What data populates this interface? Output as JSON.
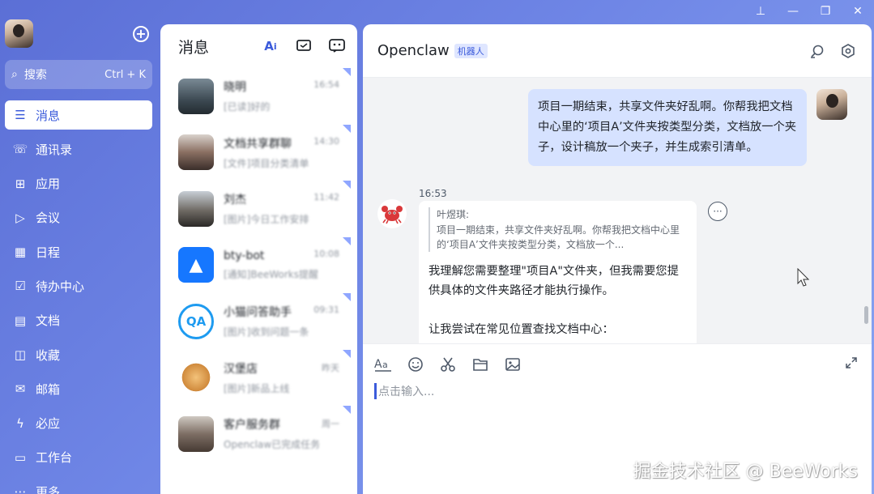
{
  "window": {
    "controls": [
      "⊥",
      "—",
      "❐",
      "✕"
    ]
  },
  "nav": {
    "search_label": "搜索",
    "search_shortcut": "Ctrl + K",
    "items": [
      {
        "label": "消息",
        "icon": "message-icon",
        "glyph": "☰",
        "active": true
      },
      {
        "label": "通讯录",
        "icon": "contacts-icon",
        "glyph": "☏",
        "active": false
      },
      {
        "label": "应用",
        "icon": "apps-icon",
        "glyph": "⊞",
        "active": false
      },
      {
        "label": "会议",
        "icon": "meeting-icon",
        "glyph": "▷",
        "active": false
      },
      {
        "label": "日程",
        "icon": "calendar-icon",
        "glyph": "▦",
        "active": false
      },
      {
        "label": "待办中心",
        "icon": "todo-icon",
        "glyph": "☑",
        "active": false
      },
      {
        "label": "文档",
        "icon": "document-icon",
        "glyph": "▤",
        "active": false
      },
      {
        "label": "收藏",
        "icon": "favorites-icon",
        "glyph": "◫",
        "active": false
      },
      {
        "label": "邮箱",
        "icon": "mail-icon",
        "glyph": "✉",
        "active": false
      },
      {
        "label": "必应",
        "icon": "lightning-icon",
        "glyph": "ϟ",
        "active": false
      },
      {
        "label": "工作台",
        "icon": "workbench-icon",
        "glyph": "▭",
        "active": false
      },
      {
        "label": "更多",
        "icon": "more-icon",
        "glyph": "⋯",
        "active": false
      }
    ]
  },
  "conversations": {
    "title": "消息",
    "header_icons": [
      "ai-icon",
      "chat-box-icon",
      "bot-chat-icon"
    ],
    "items": [
      {
        "name": "晓明",
        "preview": "[已读]好的",
        "time": "16:54",
        "avatar": "av-photo1",
        "avatar_text": ""
      },
      {
        "name": "文档共享群聊",
        "preview": "[文件]项目分类清单",
        "time": "14:30",
        "avatar": "av-photo2",
        "avatar_text": ""
      },
      {
        "name": "刘杰",
        "preview": "[图片]今日工作安排",
        "time": "11:42",
        "avatar": "av-photo3",
        "avatar_text": ""
      },
      {
        "name": "bty-bot",
        "preview": "[通知]BeeWorks提醒",
        "time": "10:08",
        "avatar": "av-blue",
        "avatar_text": "▲"
      },
      {
        "name": "小猫问答助手",
        "preview": "[图片]收到问题一条",
        "time": "09:31",
        "avatar": "av-qa",
        "avatar_text": "QA"
      },
      {
        "name": "汉堡店",
        "preview": "[图片]新品上线",
        "time": "昨天",
        "avatar": "av-food",
        "avatar_text": ""
      },
      {
        "name": "客户服务群",
        "preview": "Openclaw已完成任务",
        "time": "周一",
        "avatar": "av-photo4",
        "avatar_text": ""
      }
    ]
  },
  "chat": {
    "title": "Openclaw",
    "tag": "机器人",
    "outgoing_text": "项目一期结束，共享文件夹好乱啊。你帮我把文档中心里的‘项目A’文件夹按类型分类，文档放一个夹子，设计稿放一个夹子，并生成索引清单。",
    "time": "16:53",
    "quote_author": "叶煜琪:",
    "quote_text": "项目一期结束，共享文件夹好乱啊。你帮我把文档中心里的‘项目A’文件夹按类型分类，文档放一个...",
    "reply_p1": "我理解您需要整理\"项目A\"文件夹，但我需要您提供具体的文件夹路径才能执行操作。",
    "reply_p2": "让我尝试在常见位置查找文档中心：",
    "input_placeholder": "点击输入..."
  },
  "watermark": "掘金技术社区 @ BeeWorks"
}
